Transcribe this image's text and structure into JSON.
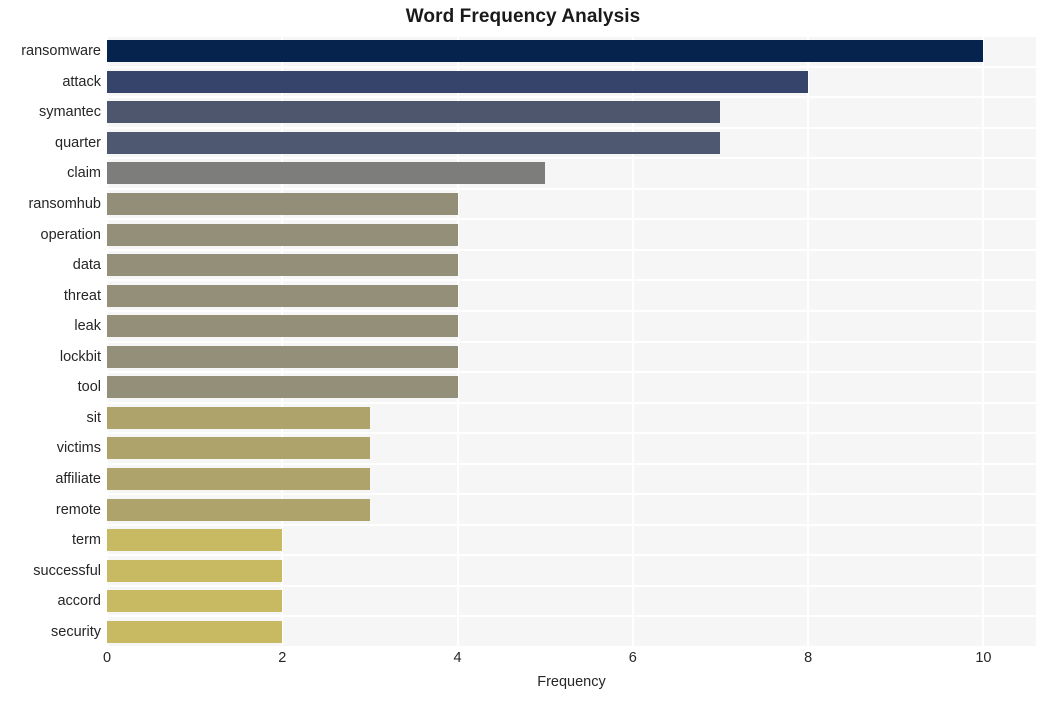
{
  "chart_data": {
    "type": "bar",
    "orientation": "horizontal",
    "title": "Word Frequency Analysis",
    "xlabel": "Frequency",
    "ylabel": "",
    "categories": [
      "ransomware",
      "attack",
      "symantec",
      "quarter",
      "claim",
      "ransomhub",
      "operation",
      "data",
      "threat",
      "leak",
      "lockbit",
      "tool",
      "sit",
      "victims",
      "affiliate",
      "remote",
      "term",
      "successful",
      "accord",
      "security"
    ],
    "values": [
      10,
      8,
      7,
      7,
      5,
      4,
      4,
      4,
      4,
      4,
      4,
      4,
      3,
      3,
      3,
      3,
      2,
      2,
      2,
      2
    ],
    "bar_colors": [
      "#06234d",
      "#36436b",
      "#4e566e",
      "#4f5871",
      "#7d7d7b",
      "#928e78",
      "#938f79",
      "#938f79",
      "#938f79",
      "#938f79",
      "#938f79",
      "#938f79",
      "#ada36b",
      "#ada36b",
      "#ada36b",
      "#ada36b",
      "#c8ba62",
      "#c8ba62",
      "#c8ba62",
      "#c8ba62"
    ],
    "xlim": [
      0,
      10.6
    ],
    "xticks": [
      0,
      2,
      4,
      6,
      8,
      10
    ],
    "xtick_labels": [
      "0",
      "2",
      "4",
      "6",
      "8",
      "10"
    ],
    "grid": true,
    "grid_color": "#ffffff",
    "plot_background": "#f6f6f6",
    "figure_background": "#ffffff",
    "legend": null
  }
}
